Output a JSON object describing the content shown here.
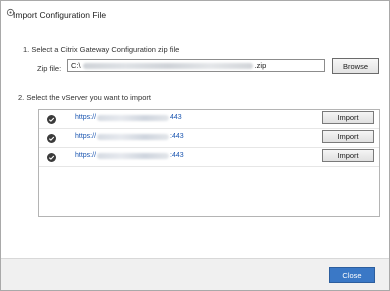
{
  "dialog": {
    "title": "Import Configuration File",
    "icon": "app-icon"
  },
  "step1": {
    "label": "1. Select a Citrix Gateway Configuration zip file",
    "zip_label": "Zip file:",
    "zip_value_prefix": "C:\\",
    "zip_value_suffix": ".zip",
    "browse_label": "Browse"
  },
  "step2": {
    "label": "2. Select the vServer you want to import",
    "rows": [
      {
        "url_prefix": "https://",
        "url_suffix": "443",
        "import_label": "Import"
      },
      {
        "url_prefix": "https://",
        "url_suffix": ":443",
        "import_label": "Import"
      },
      {
        "url_prefix": "https://",
        "url_suffix": ":443",
        "import_label": "Import"
      }
    ]
  },
  "footer": {
    "close_label": "Close"
  },
  "colors": {
    "link": "#1a55b0",
    "primary_button": "#3a78c6"
  }
}
